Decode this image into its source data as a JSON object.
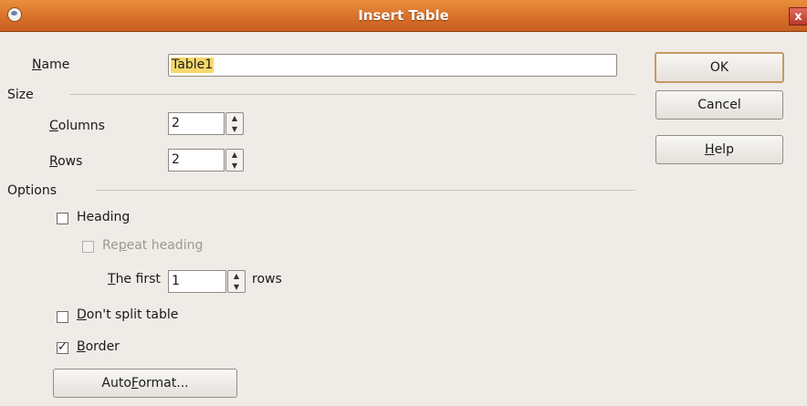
{
  "window": {
    "title": "Insert Table",
    "close_glyph": "x"
  },
  "name": {
    "label": "Name",
    "value": "Table1"
  },
  "size": {
    "section_label": "Size",
    "columns_label": "Columns",
    "columns_value": "2",
    "rows_label": "Rows",
    "rows_value": "2"
  },
  "options": {
    "section_label": "Options",
    "heading_label": "Heading",
    "heading_checked": false,
    "repeat_heading_label": "Repeat heading",
    "repeat_heading_enabled": false,
    "the_first_label": "The first",
    "the_first_value": "1",
    "rows_suffix": "rows",
    "dont_split_label": "Don't split table",
    "dont_split_checked": false,
    "border_label": "Border",
    "border_checked": true,
    "autoformat_label": "AutoFormat..."
  },
  "buttons": {
    "ok": "OK",
    "cancel": "Cancel",
    "help": "Help"
  },
  "icons": {
    "up": "▲",
    "down": "▼"
  }
}
